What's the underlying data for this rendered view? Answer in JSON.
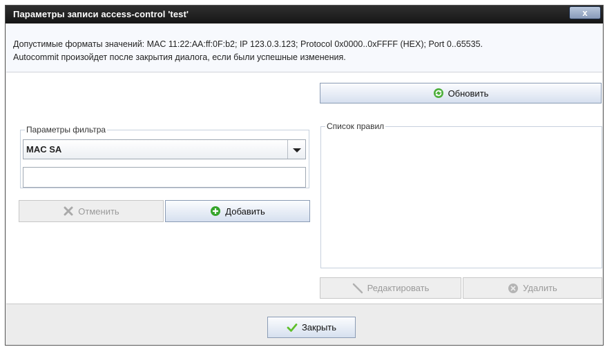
{
  "window": {
    "title": "Параметры записи access-control 'test'",
    "close_label": "x"
  },
  "info": {
    "line1": "Допустимые форматы значений: MAC 11:22:AA:ff:0F:b2; IP 123.0.3.123; Protocol 0x0000..0xFFFF (HEX); Port 0..65535.",
    "line2": "Autocommit произойдет после закрытия диалога, если были успешные изменения."
  },
  "toolbar": {
    "refresh_label": "Обновить"
  },
  "filter": {
    "legend": "Параметры фильтра",
    "selected": "MAC SA",
    "value": "",
    "cancel_label": "Отменить",
    "add_label": "Добавить"
  },
  "rules": {
    "legend": "Список правил",
    "items": [],
    "edit_label": "Редактировать",
    "delete_label": "Удалить"
  },
  "footer": {
    "close_label": "Закрыть"
  },
  "colors": {
    "titlebar": "#1c1c1c",
    "refresh_icon": "#4caf3a",
    "add_icon": "#36a52b",
    "check_icon": "#5fbf2b"
  }
}
